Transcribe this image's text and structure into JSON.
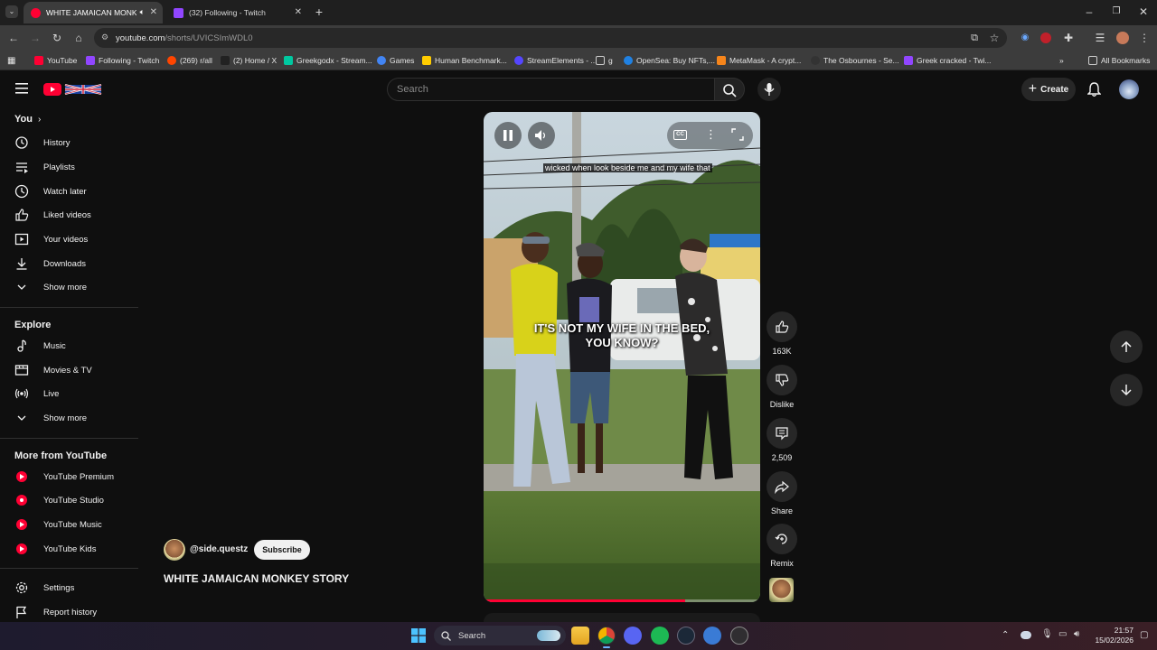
{
  "browser": {
    "tabs": [
      {
        "title": "WHITE JAMAICAN MONKEY",
        "active": true,
        "favicon_color": "#ff0033"
      },
      {
        "title": "(32) Following - Twitch",
        "active": false,
        "favicon_color": "#9146ff"
      }
    ],
    "url_host": "youtube.com",
    "url_path": "/shorts/UVICSImWDL0",
    "bookmarks": [
      {
        "label": "YouTube",
        "color": "#ff0033"
      },
      {
        "label": "Following - Twitch",
        "color": "#9146ff"
      },
      {
        "label": "(269) r/all",
        "color": "#ff4500"
      },
      {
        "label": "(2) Home / X",
        "color": "#222222"
      },
      {
        "label": "Greekgodx - Stream...",
        "color": "#00c8a0"
      },
      {
        "label": "Games",
        "color": "#4285f4"
      },
      {
        "label": "Human Benchmark...",
        "color": "#ffcc00"
      },
      {
        "label": "StreamElements - ...",
        "color": "#5546ff"
      },
      {
        "label": "g",
        "color": "#555555"
      },
      {
        "label": "OpenSea: Buy NFTs,...",
        "color": "#2081e2"
      },
      {
        "label": "MetaMask - A crypt...",
        "color": "#f6851b"
      },
      {
        "label": "The Osbournes - Se...",
        "color": "#333333"
      },
      {
        "label": "Greek cracked - Twi...",
        "color": "#9146ff"
      }
    ],
    "all_bookmarks": "All Bookmarks"
  },
  "youtube": {
    "search_placeholder": "Search",
    "create_label": "Create",
    "sidebar": {
      "you_label": "You",
      "you_items": [
        {
          "label": "History",
          "icon": "history-icon"
        },
        {
          "label": "Playlists",
          "icon": "playlists-icon"
        },
        {
          "label": "Watch later",
          "icon": "watch-later-icon"
        },
        {
          "label": "Liked videos",
          "icon": "like-icon"
        },
        {
          "label": "Your videos",
          "icon": "your-videos-icon"
        },
        {
          "label": "Downloads",
          "icon": "download-icon"
        },
        {
          "label": "Show more",
          "icon": "chevron-down-icon"
        }
      ],
      "explore_label": "Explore",
      "explore_items": [
        {
          "label": "Music",
          "icon": "music-icon"
        },
        {
          "label": "Movies & TV",
          "icon": "movies-icon"
        },
        {
          "label": "Live",
          "icon": "live-icon"
        },
        {
          "label": "Show more",
          "icon": "chevron-down-icon"
        }
      ],
      "more_label": "More from YouTube",
      "more_items": [
        {
          "label": "YouTube Premium"
        },
        {
          "label": "YouTube Studio"
        },
        {
          "label": "YouTube Music"
        },
        {
          "label": "YouTube Kids"
        }
      ],
      "bottom_items": [
        {
          "label": "Settings",
          "icon": "settings-icon"
        },
        {
          "label": "Report history",
          "icon": "flag-icon"
        }
      ]
    },
    "short": {
      "caption_small": "wicked when look beside me and my wife that",
      "caption_big": "IT'S NOT MY WIFE IN THE BED, YOU KNOW?",
      "cc_label": "CC",
      "channel": "@side.questz",
      "subscribe_label": "Subscribe",
      "title": "WHITE JAMAICAN MONKEY STORY",
      "progress": 0.73
    },
    "actions": {
      "likes": "163K",
      "dislike": "Dislike",
      "comments": "2,509",
      "share": "Share",
      "remix": "Remix"
    }
  },
  "taskbar": {
    "search_label": "Search",
    "time": "21:57",
    "date": "15/02/2026"
  }
}
